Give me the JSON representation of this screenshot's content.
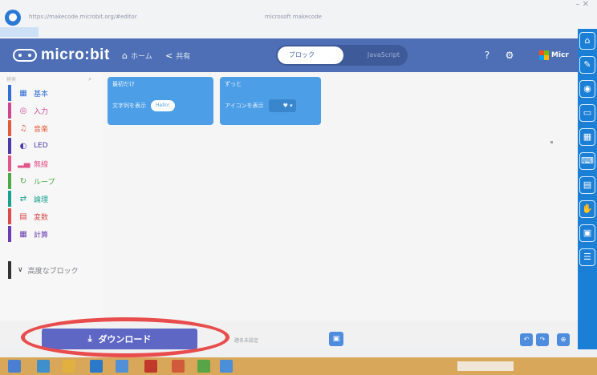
{
  "browser": {
    "url_left": "https://makecode.microbit.org/#editor",
    "url_right": "microsoft makecode",
    "window_controls": "– ✕"
  },
  "header": {
    "brand": "micro:bit",
    "home_label": "ホーム",
    "share_label": "共有",
    "toggle_blocks": "ブロック",
    "toggle_js": "JavaScript",
    "brand_right": "Micr",
    "ms_colors": [
      "#f25022",
      "#7fba00",
      "#00a4ef",
      "#ffb900"
    ]
  },
  "sidebar": {
    "search_placeholder": "検索",
    "categories": [
      {
        "label": "基本",
        "color": "#2f6fd6",
        "icon": "grid-icon"
      },
      {
        "label": "入力",
        "color": "#d24593",
        "icon": "input-icon"
      },
      {
        "label": "音楽",
        "color": "#e35c3a",
        "icon": "headphone-icon"
      },
      {
        "label": "LED",
        "color": "#4b3aa6",
        "icon": "led-icon"
      },
      {
        "label": "無線",
        "color": "#e1568a",
        "icon": "bars-icon"
      },
      {
        "label": "ループ",
        "color": "#4aaa45",
        "icon": "loop-icon"
      },
      {
        "label": "論理",
        "color": "#1aa18e",
        "icon": "logic-icon"
      },
      {
        "label": "変数",
        "color": "#dd4a4a",
        "icon": "list-icon"
      },
      {
        "label": "計算",
        "color": "#6b3db3",
        "icon": "calc-icon"
      }
    ],
    "advanced_label": "高度なブロック"
  },
  "workspace": {
    "block1_header": "最初だけ",
    "block1_row": "文字列を表示",
    "block1_value": "Hello!",
    "block2_header": "ずっと",
    "block2_row": "アイコンを表示",
    "block2_value": "♥"
  },
  "bottom": {
    "download_label": "ダウンロード",
    "project_name": "題名未設定"
  }
}
